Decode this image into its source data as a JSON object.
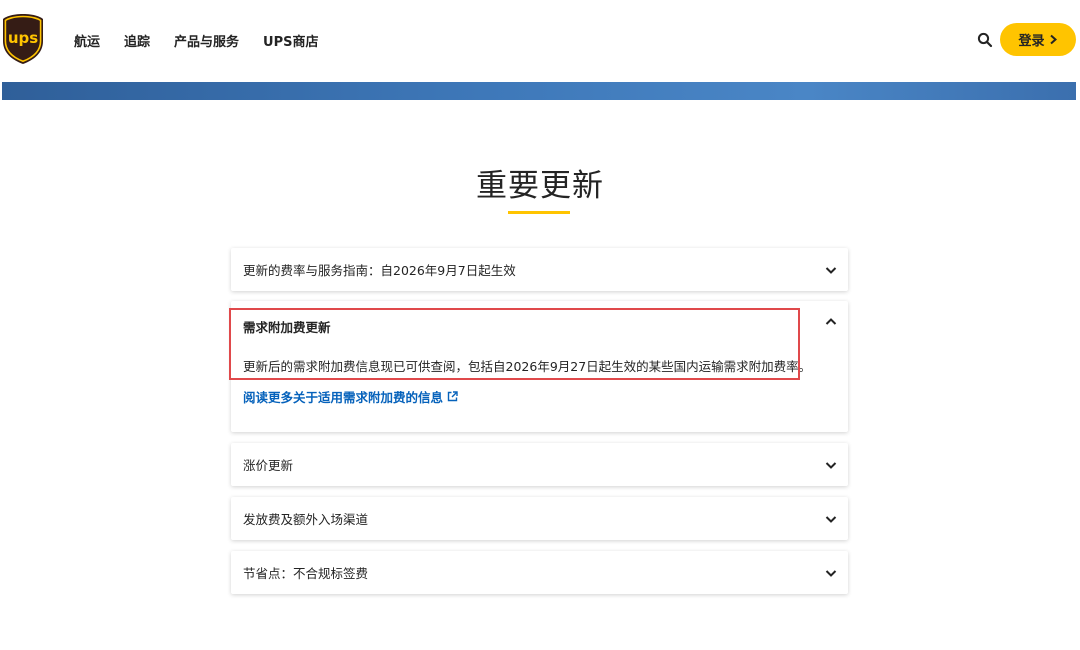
{
  "header": {
    "logo_text": "ups",
    "nav": [
      "航运",
      "追踪",
      "产品与服务",
      "UPS商店"
    ],
    "login_label": "登录",
    "colors": {
      "brand_brown": "#351c15",
      "brand_gold": "#ffc400",
      "link_blue": "#0662bb"
    }
  },
  "page": {
    "title": "重要更新"
  },
  "accordions": {
    "item1": {
      "label": "更新的费率与服务指南：自2026年9月7日起生效",
      "expanded": false
    },
    "item2": {
      "label": "需求附加费更新",
      "expanded": true,
      "body": "更新后的需求附加费信息现已可供查阅，包括自2026年9月27日起生效的某些国内运输需求附加费率。",
      "link": "阅读更多关于适用需求附加费的信息"
    },
    "item3": {
      "label": "涨价更新",
      "expanded": false
    },
    "item4": {
      "label": "发放费及额外入场渠道",
      "expanded": false
    },
    "item5": {
      "label": "节省点：不合规标签费",
      "expanded": false
    }
  },
  "icons": {
    "search": "search-icon",
    "login_chevron": "chevron-right-icon",
    "collapsed": "chevron-down-icon",
    "expanded": "chevron-up-icon",
    "external_link": "external-link-icon"
  }
}
